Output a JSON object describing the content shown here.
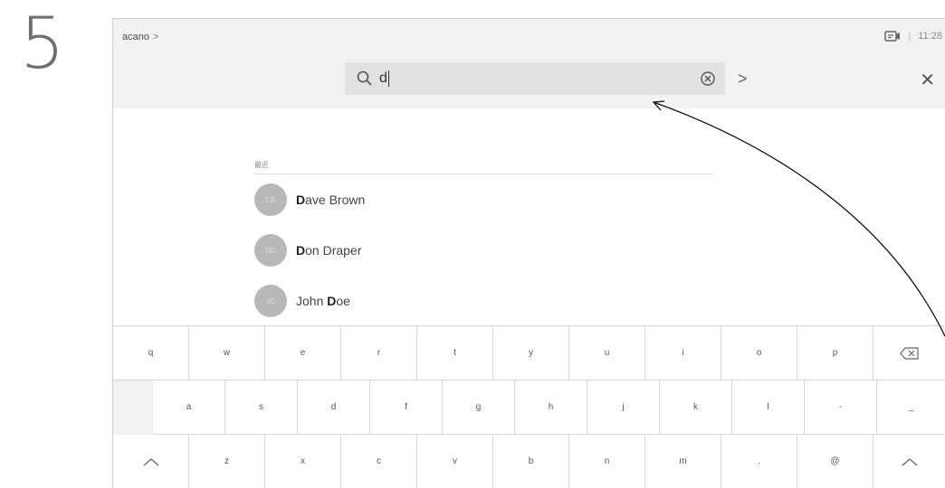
{
  "step_number": "5",
  "header": {
    "breadcrumb": "acano",
    "breadcrumb_chevron": ">",
    "time": "11:28",
    "separator": "|",
    "video_icon": "video-camera-icon"
  },
  "search": {
    "query": "d",
    "search_icon": "search-icon",
    "clear_icon": "clear-circle-icon",
    "go_label": ">",
    "close_label": "✕"
  },
  "results": {
    "section_label": "最近",
    "contacts": [
      {
        "initials": "DB",
        "match": "D",
        "rest": "ave Brown"
      },
      {
        "initials": "DD",
        "match": "D",
        "rest": "on Draper"
      },
      {
        "initials": "JD",
        "prefix": "John ",
        "match": "D",
        "rest": "oe"
      }
    ]
  },
  "keyboard": {
    "row1": [
      "q",
      "w",
      "e",
      "r",
      "t",
      "y",
      "u",
      "i",
      "o",
      "p",
      "⌫"
    ],
    "row2": [
      "a",
      "s",
      "d",
      "f",
      "g",
      "h",
      "j",
      "k",
      "l",
      "-",
      "_"
    ],
    "row3": [
      "^",
      "z",
      "x",
      "c",
      "v",
      "b",
      "n",
      "m",
      ".",
      "@",
      "^"
    ]
  }
}
